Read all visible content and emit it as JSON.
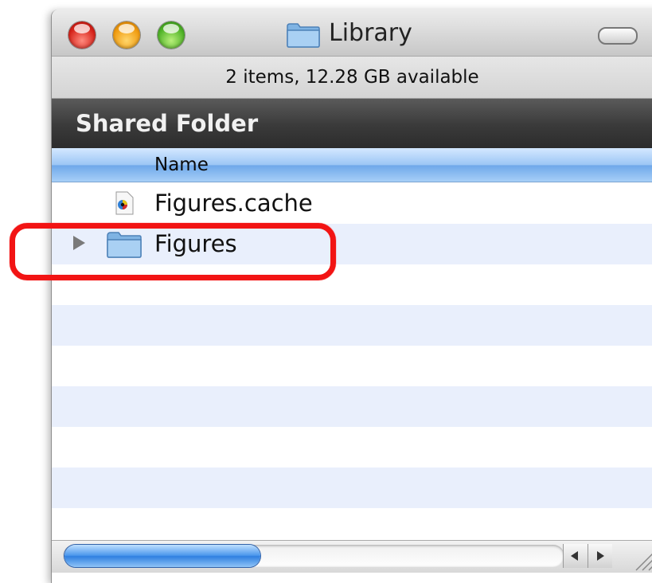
{
  "window": {
    "title": "Library",
    "status": "2 items, 12.28 GB available"
  },
  "sidebar_header": {
    "label": "Shared Folder"
  },
  "columns": {
    "name": "Name"
  },
  "items": [
    {
      "name": "Figures.cache",
      "icon": "cache-file-icon",
      "expandable": false
    },
    {
      "name": "Figures",
      "icon": "folder-icon",
      "expandable": true
    }
  ],
  "annotation": {
    "color": "#f21414"
  }
}
